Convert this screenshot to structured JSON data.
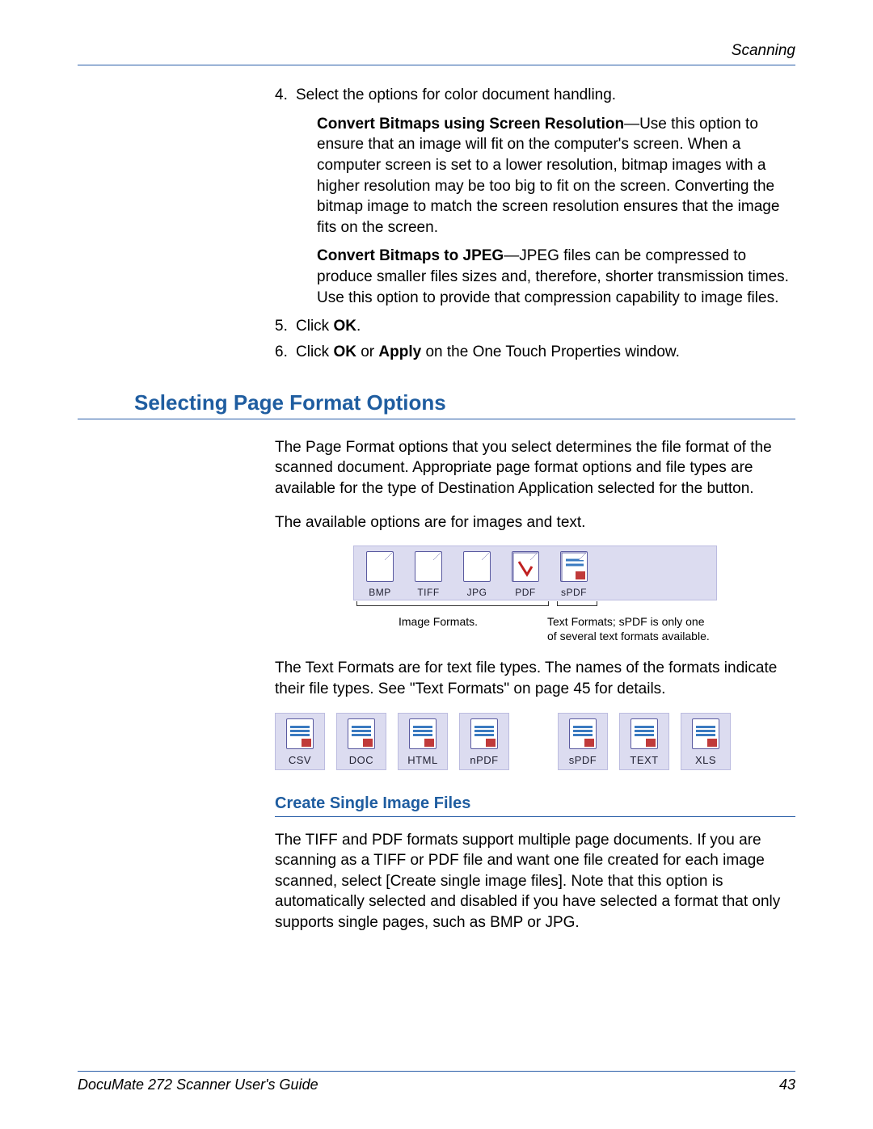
{
  "header": {
    "section": "Scanning"
  },
  "steps": {
    "s4": {
      "num": "4.",
      "lead": "Select the options for color document handling.",
      "p1_bold": "Convert Bitmaps using Screen Resolution",
      "p1_rest": "—Use this option to ensure that an image will fit on the computer's screen. When a computer screen is set to a lower resolution, bitmap images with a higher resolution may be too big to fit on the screen. Converting the bitmap image to match the screen resolution ensures that the image fits on the screen.",
      "p2_bold": "Convert Bitmaps to JPEG",
      "p2_rest": "—JPEG files can be compressed to produce smaller files sizes and, therefore, shorter transmission times. Use this option to provide that compression capability to image files."
    },
    "s5": {
      "num": "5.",
      "pre": "Click ",
      "b": "OK",
      "post": "."
    },
    "s6": {
      "num": "6.",
      "pre": "Click ",
      "b1": "OK",
      "mid": " or ",
      "b2": "Apply",
      "post": " on the One Touch Properties window."
    }
  },
  "section1": {
    "title": "Selecting Page Format Options",
    "p1": "The Page Format options that you select determines the file format of the scanned document. Appropriate page format options and file types are available for the type of Destination Application selected for the button.",
    "p2": "The available options are for images and text.",
    "image_formats": [
      "BMP",
      "TIFF",
      "JPG",
      "PDF",
      "sPDF"
    ],
    "caption_left": "Image Formats.",
    "caption_right": "Text Formats; sPDF is only one of several text formats available.",
    "p3": "The Text Formats are for text file types. The names of the formats indicate their file types. See \"Text Formats\" on page 45 for details.",
    "text_formats_a": [
      "CSV",
      "DOC",
      "HTML",
      "nPDF"
    ],
    "text_formats_b": [
      "sPDF",
      "TEXT",
      "XLS"
    ]
  },
  "section2": {
    "title": "Create Single Image Files",
    "p1": "The TIFF and PDF formats support multiple page documents. If you are scanning as a TIFF or PDF file and want one file created for each image scanned, select [Create single image files].  Note that this option is automatically selected and disabled if you have selected a format that only supports single pages, such as BMP or JPG."
  },
  "footer": {
    "left": "DocuMate 272 Scanner User's Guide",
    "right": "43"
  }
}
